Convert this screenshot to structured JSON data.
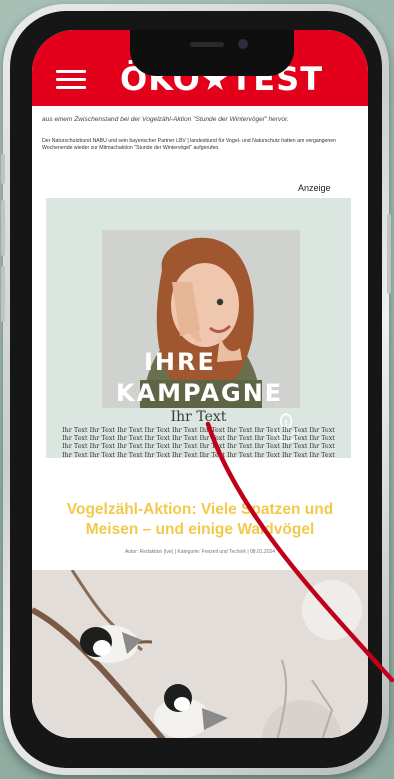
{
  "header": {
    "logo": "ÖKO★TEST",
    "menu_icon": "hamburger-menu-icon"
  },
  "article_intro": {
    "lead": "aus einem Zwischenstand bei der Vogelzähl-Aktion \"Stunde der Wintervögel\" hervor.",
    "paragraph": "Der Naturschutzbund NABU und sein bayerischer Partner LBV | landesbund für Vogel- und Naturschutz hatten am vergangenen Wochenende wieder zur Mitmachaktion \"Stunde der Wintervögel\" aufgerufen."
  },
  "ad": {
    "label": "Anzeige",
    "title_line1": "IHRE",
    "title_line2": "KAMPAGNE",
    "subtitle": "Ihr Text",
    "filler": "Ihr Text Ihr Text Ihr Text Ihr Text Ihr Text Ihr Text Ihr Text Ihr Text Ihr Text Ihr Text Ihr Text Ihr Text Ihr Text Ihr Text Ihr Text Ihr Text Ihr Text Ihr Text Ihr Text Ihr Text Ihr Text Ihr Text Ihr Text Ihr Text Ihr Text Ihr Text Ihr Text Ihr Text Ihr Text Ihr Text Ihr Text Ihr Text Ihr Text Ihr Text Ihr Text Ihr Text Ihr Text Ihr Text Ihr Text Ihr Text"
  },
  "article": {
    "headline": "Vogelzähl-Aktion: Viele Spatzen und Meisen – und einige Waldvögel",
    "meta": "Autor: Redaktion (lve) | Kategorie: Freizeit und Technik | 08.01.2024"
  },
  "colors": {
    "brand_red": "#e3001b",
    "headline_yellow": "#f2c94c",
    "arrow_red": "#c0001a"
  }
}
